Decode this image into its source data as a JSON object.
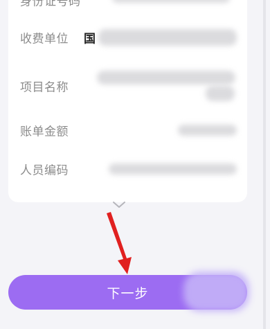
{
  "form": {
    "rows": [
      {
        "label": "身份证号码"
      },
      {
        "label": "收费单位",
        "visible_value": "国"
      },
      {
        "label": "项目名称"
      },
      {
        "label": "账单金额"
      },
      {
        "label": "人员编码"
      }
    ]
  },
  "expand_icon": "chevron-down-icon",
  "next_button": {
    "label": "下一步",
    "color": "#9c6cf2"
  },
  "annotation_arrow_color": "#e02020"
}
